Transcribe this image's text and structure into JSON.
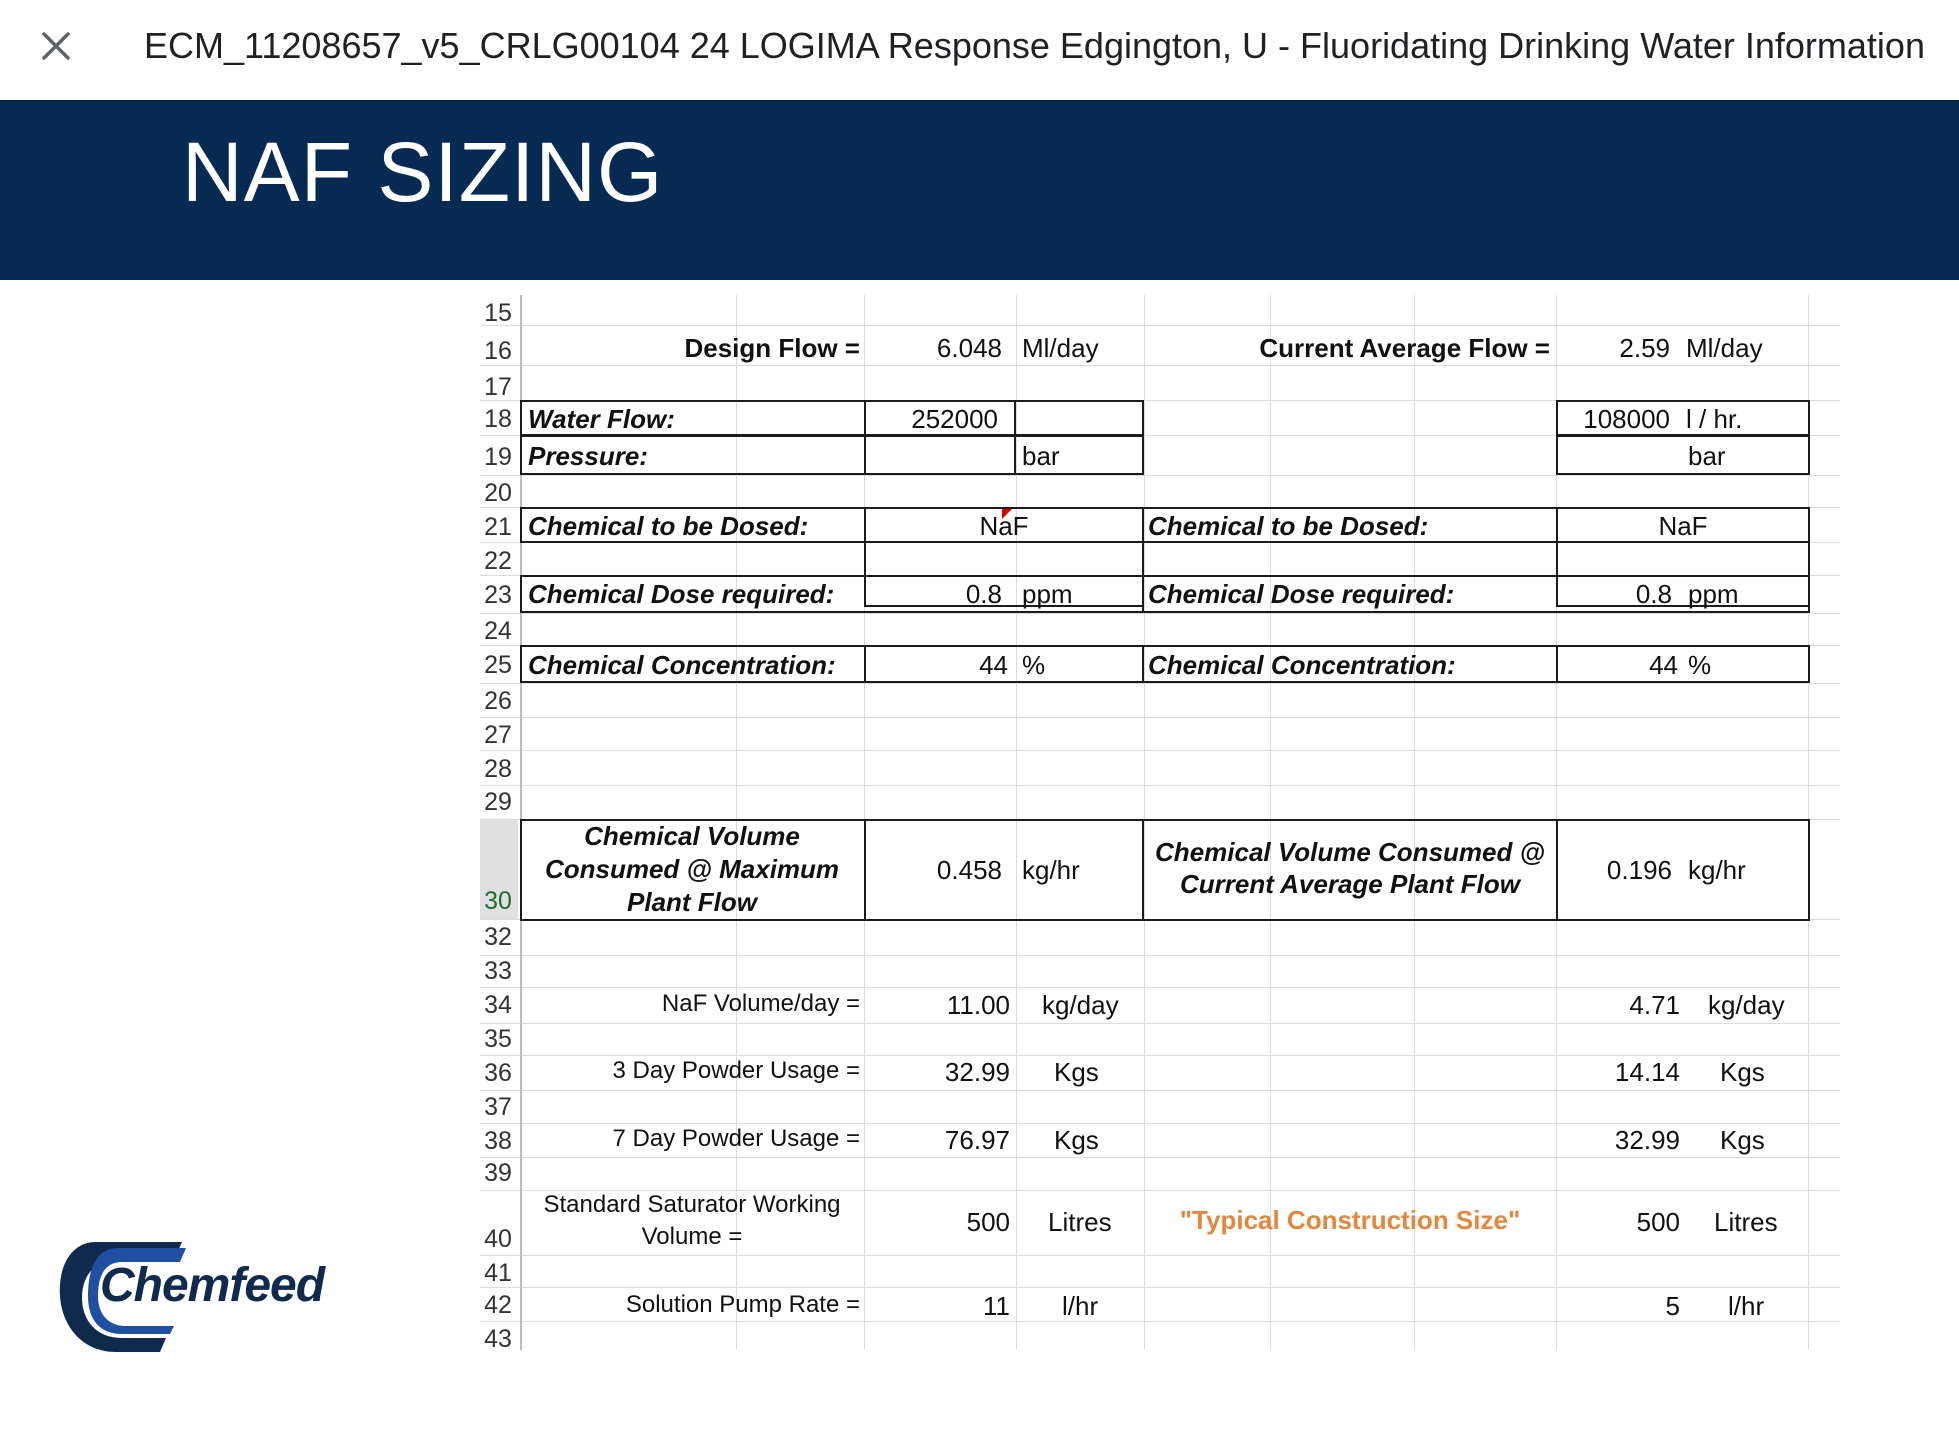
{
  "viewer": {
    "document_title": "ECM_11208657_v5_CRLG00104 24 LOGIMA Response Edgington, U - Fluoridating Drinking Water Information"
  },
  "slide": {
    "title": "NAF SIZING"
  },
  "sheet": {
    "row_numbers": [
      "15",
      "16",
      "17",
      "18",
      "19",
      "20",
      "21",
      "22",
      "23",
      "24",
      "25",
      "26",
      "27",
      "28",
      "29",
      "30",
      "32",
      "33",
      "34",
      "35",
      "36",
      "37",
      "38",
      "39",
      "40",
      "41",
      "42",
      "43"
    ],
    "design": {
      "label": "Design Flow =",
      "value": "6.048",
      "unit": "Ml/day",
      "water_flow_label": "Water Flow:",
      "water_flow_value": "252000",
      "pressure_label": "Pressure:",
      "pressure_unit": "bar",
      "chem_label": "Chemical to be Dosed:",
      "chem_value": "NaF",
      "dose_label": "Chemical Dose required:",
      "dose_value": "0.8",
      "dose_unit": "ppm",
      "conc_label": "Chemical Concentration:",
      "conc_value": "44",
      "conc_unit": "%",
      "volume_label_1": "Chemical Volume",
      "volume_label_2": "Consumed @ Maximum",
      "volume_label_3": "Plant Flow",
      "volume_value": "0.458",
      "volume_unit": "kg/hr"
    },
    "current": {
      "label": "Current Average Flow =",
      "value": "2.59",
      "unit": "Ml/day",
      "water_flow_value": "108000",
      "water_flow_unit": "l / hr.",
      "pressure_unit": "bar",
      "chem_label": "Chemical to be Dosed:",
      "chem_value": "NaF",
      "dose_label": "Chemical Dose required:",
      "dose_value": "0.8",
      "dose_unit": "ppm",
      "conc_label": "Chemical Concentration:",
      "conc_value": "44",
      "conc_unit": "%",
      "volume_label_1": "Chemical Volume Consumed @",
      "volume_label_2": "Current Average Plant Flow",
      "volume_value": "0.196",
      "volume_unit": "kg/hr"
    },
    "results": [
      {
        "label": "NaF Volume/day =",
        "design_value": "11.00",
        "design_unit": "kg/day",
        "current_value": "4.71",
        "current_unit": "kg/day"
      },
      {
        "label": "3 Day Powder Usage =",
        "design_value": "32.99",
        "design_unit": "Kgs",
        "current_value": "14.14",
        "current_unit": "Kgs"
      },
      {
        "label": "7 Day Powder Usage =",
        "design_value": "76.97",
        "design_unit": "Kgs",
        "current_value": "32.99",
        "current_unit": "Kgs"
      },
      {
        "label_1": "Standard Saturator Working",
        "label_2": "Volume =",
        "design_value": "500",
        "design_unit": "Litres",
        "note": "\"Typical Construction Size\"",
        "current_value": "500",
        "current_unit": "Litres"
      },
      {
        "label": "Solution Pump Rate =",
        "design_value": "11",
        "design_unit": "l/hr",
        "current_value": "5",
        "current_unit": "l/hr"
      }
    ]
  },
  "logo": {
    "text": "Chemfeed",
    "colors": {
      "navy": "#0f2a4d",
      "blue": "#1f4fa0"
    }
  },
  "colors": {
    "banner": "#062a51",
    "note_orange": "#e4873e"
  }
}
